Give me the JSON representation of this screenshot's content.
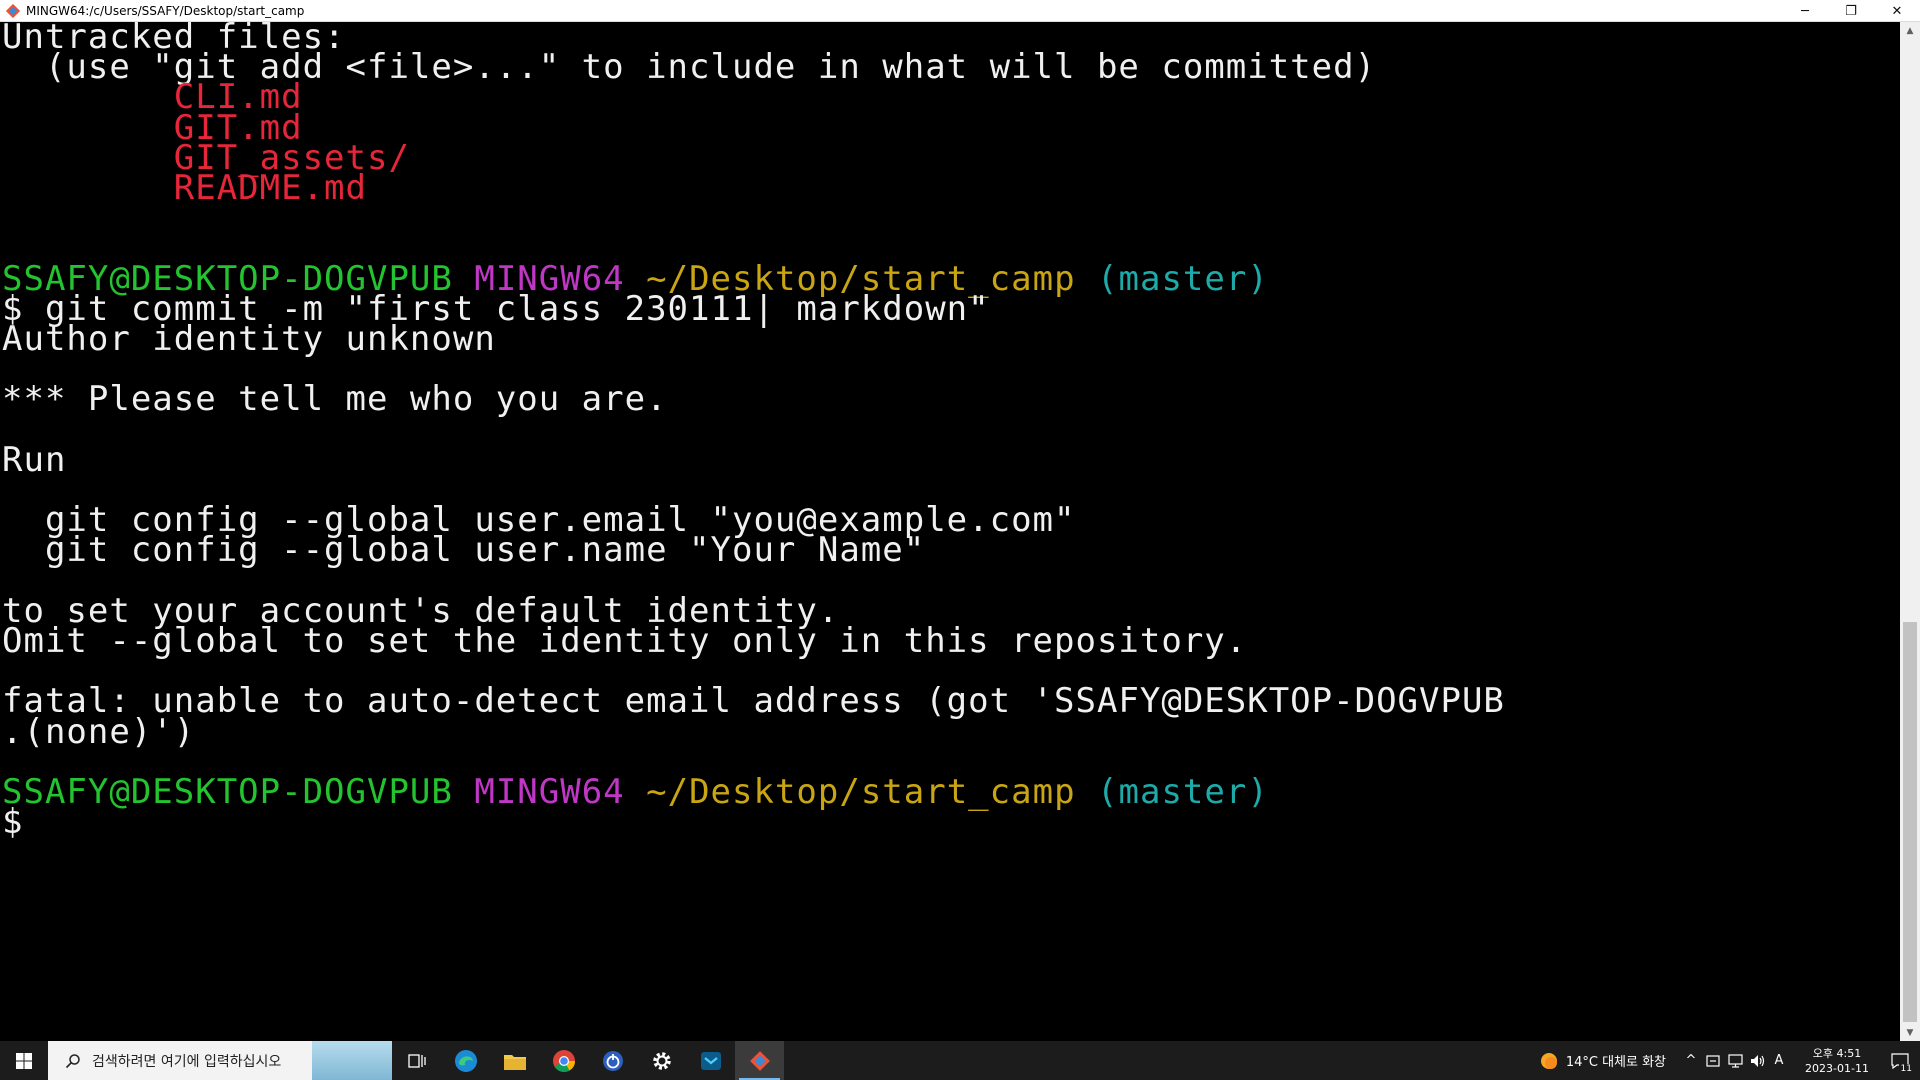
{
  "window": {
    "title": "MINGW64:/c/Users/SSAFY/Desktop/start_camp",
    "minimize_glyph": "─",
    "restore_glyph": "❐",
    "close_glyph": "✕"
  },
  "terminal": {
    "colors": {
      "default": "#f0f0f0",
      "red": "#e8263a",
      "green": "#23c42f",
      "magenta": "#c037c6",
      "yellow": "#c9a514",
      "cyan": "#1eaaa9"
    },
    "lines": [
      [
        {
          "t": "Untracked files:",
          "c": "default"
        }
      ],
      [
        {
          "t": "  (use \"git add <file>...\" to include in what will be committed)",
          "c": "default"
        }
      ],
      [
        {
          "t": "        CLI.md",
          "c": "red"
        }
      ],
      [
        {
          "t": "        GIT.md",
          "c": "red"
        }
      ],
      [
        {
          "t": "        GIT_assets/",
          "c": "red"
        }
      ],
      [
        {
          "t": "        README.md",
          "c": "red"
        }
      ],
      [],
      [],
      [
        {
          "t": "SSAFY@DESKTOP-DOGVPUB",
          "c": "green"
        },
        {
          "t": " ",
          "c": "default"
        },
        {
          "t": "MINGW64",
          "c": "magenta"
        },
        {
          "t": " ",
          "c": "default"
        },
        {
          "t": "~/Desktop/start_camp",
          "c": "yellow"
        },
        {
          "t": " ",
          "c": "default"
        },
        {
          "t": "(master)",
          "c": "cyan"
        }
      ],
      [
        {
          "t": "$ git commit -m \"first class 230111| markdown\"",
          "c": "default"
        }
      ],
      [
        {
          "t": "Author identity unknown",
          "c": "default"
        }
      ],
      [],
      [
        {
          "t": "*** Please tell me who you are.",
          "c": "default"
        }
      ],
      [],
      [
        {
          "t": "Run",
          "c": "default"
        }
      ],
      [],
      [
        {
          "t": "  git config --global user.email \"you@example.com\"",
          "c": "default"
        }
      ],
      [
        {
          "t": "  git config --global user.name \"Your Name\"",
          "c": "default"
        }
      ],
      [],
      [
        {
          "t": "to set your account's default identity.",
          "c": "default"
        }
      ],
      [
        {
          "t": "Omit --global to set the identity only in this repository.",
          "c": "default"
        }
      ],
      [],
      [
        {
          "t": "fatal: unable to auto-detect email address (got 'SSAFY@DESKTOP-DOGVPUB",
          "c": "default"
        }
      ],
      [
        {
          "t": ".(none)')",
          "c": "default"
        }
      ],
      [],
      [
        {
          "t": "SSAFY@DESKTOP-DOGVPUB",
          "c": "green"
        },
        {
          "t": " ",
          "c": "default"
        },
        {
          "t": "MINGW64",
          "c": "magenta"
        },
        {
          "t": " ",
          "c": "default"
        },
        {
          "t": "~/Desktop/start_camp",
          "c": "yellow"
        },
        {
          "t": " ",
          "c": "default"
        },
        {
          "t": "(master)",
          "c": "cyan"
        }
      ],
      [
        {
          "t": "$",
          "c": "default"
        }
      ]
    ]
  },
  "taskbar": {
    "search_placeholder": "검색하려면 여기에 입력하십시오",
    "apps": [
      {
        "name": "task-view-icon"
      },
      {
        "name": "edge-icon"
      },
      {
        "name": "file-explorer-icon"
      },
      {
        "name": "chrome-icon"
      },
      {
        "name": "power-app-icon"
      },
      {
        "name": "settings-icon"
      },
      {
        "name": "terminal-app-icon"
      },
      {
        "name": "git-bash-icon",
        "active": true
      }
    ],
    "weather": "14°C  대체로 화창",
    "tray": {
      "chevron": "^",
      "ime": "A"
    },
    "clock_time": "오후 4:51",
    "clock_date": "2023-01-11",
    "notification_count": "11"
  }
}
